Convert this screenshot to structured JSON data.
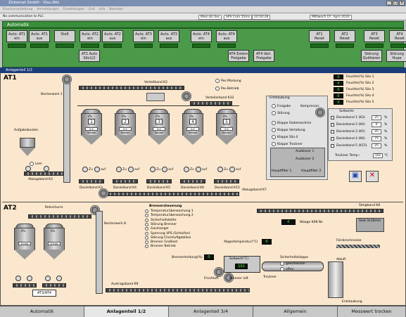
{
  "window": {
    "title": "Zirkomat GmbH",
    "title_suffix": "Visu.Wiz"
  },
  "toolbar": {
    "items": [
      "Druckverarbeitung",
      "Anmeldungen",
      "Einstellungen",
      "Exit",
      "Info",
      "Beenden"
    ]
  },
  "status": {
    "message": "No communication to PLC",
    "main": "Main 82.0ec",
    "sps": "SPS Com 55ms",
    "time": "10:50:28",
    "date": "Mittwoch 07. April 2010"
  },
  "auto": {
    "label": "Automatik",
    "buttons": [
      {
        "l1": "Auto. AT1",
        "l2": "ein"
      },
      {
        "l1": "Auto. AT1",
        "l2": "aus"
      },
      {
        "l1": "Stoß",
        "l2": ""
      },
      {
        "l1": "Auto. AT2",
        "l2": "ein"
      },
      {
        "l1": "Auto. AT2",
        "l2": "aus"
      },
      {
        "l1": "Auto. AT3",
        "l2": "ein"
      },
      {
        "l1": "Auto. AT3",
        "l2": "aus"
      },
      {
        "l1": "Auto. AT4",
        "l2": "ein"
      },
      {
        "l1": "Auto. AT4",
        "l2": "aus"
      },
      {
        "l1": "AT1",
        "l2": "Reset"
      },
      {
        "l1": "AT2",
        "l2": "Reset"
      },
      {
        "l1": "AT3",
        "l2": "Reset"
      },
      {
        "l1": "AT4",
        "l2": "Reset"
      }
    ],
    "buttons2": [
      {
        "l1": "AT2 Auto",
        "l2": "Silo1/2"
      },
      {
        "l1": "AT4 Extern",
        "l2": "Freigabe"
      },
      {
        "l1": "AT4 Verl.",
        "l2": "Freigabe"
      },
      {
        "l1": "Störung",
        "l2": "Quittieren"
      },
      {
        "l1": "Störung",
        "l2": "Hupe"
      }
    ]
  },
  "sub": {
    "title": "Anlagenteil 1/2"
  },
  "at1": {
    "title": "AT1",
    "labels": {
      "becherwerk": "Becherwerk 1",
      "verteilband": "Verteilband K2",
      "vb_k32": "Verteilerband K32",
      "pos_mark": "Pos.Markung",
      "pos_betrieb": "Pos.Betrieb",
      "aufgabe": "Aufgabebunker",
      "leer": "Leer",
      "abzug": "Abzugsband K3",
      "abzug2": "Abzugsband K7"
    },
    "silos": [
      {
        "n": "1",
        "pct": "0%",
        "txt": "0.2 Shilder"
      },
      {
        "n": "2",
        "pct": "0%",
        "txt": "0.2 Shilder"
      },
      {
        "n": "3",
        "pct": "0%",
        "txt": "0.2 Shilder"
      },
      {
        "n": "4",
        "pct": "0%",
        "txt": "0.2 Shilder"
      },
      {
        "n": "5",
        "pct": "0%",
        "txt": "0.2 Shilder"
      }
    ],
    "dosierband": [
      "Dosierband K3",
      "Dosierband K4",
      "Dosierband K5",
      "Dosierband K6",
      "Dosierband K15"
    ],
    "valves": [
      "Zu",
      "auf"
    ],
    "entstaubung": {
      "title": "Entstaubung",
      "freigabe": "Freigabe",
      "storung": "Störung",
      "kompressor": "Kompressor",
      "items": [
        "Klappe Siebmaschine",
        "Klappe Verladung",
        "Klappe Silo 4",
        "Klappe Trockner"
      ],
      "ausblaser1": "Ausblaser 1",
      "ausblaser2": "Ausblaser 2",
      "haupt1": "Hauptfilter 1",
      "haupt2": "Hauptfilter 2"
    },
    "feuchte": [
      "Feuchte(%) Silo 1",
      "Feuchte(%) Silo 2",
      "Feuchte(%) Silo 3",
      "Feuchte(%) Silo 4",
      "Feuchte(%) Silo 5"
    ],
    "feuchte_vals": [
      "0",
      "0",
      "0",
      "0",
      "0"
    ],
    "sollwerte": {
      "title": "Sollwerte",
      "items": [
        "Dosierband 1 (K3)",
        "Dosierband 2 (K4)",
        "Dosierband 3 (K5)",
        "Dosierband 4 (K6)",
        "Dosierband 5 (K15)"
      ],
      "values": [
        "25",
        "0",
        "25",
        "75",
        "25"
      ],
      "unit": "%",
      "temp_label": "Trockner Temp.:",
      "temp_val": "102",
      "temp_unit": "°C"
    }
  },
  "at2": {
    "title": "AT2",
    "labels": {
      "rohschurre": "Rohschurre",
      "becherwerk": "Becherwerk 8",
      "brenner": "Brennersteuerung",
      "steigband": "Steigband K8",
      "waage": "Waage K08 Nz",
      "sieb": "Sieb 3x10mm",
      "foerder": "Förderschnecke",
      "abgas": "Abgastemperatur(°C)",
      "brennerleistung": "Brennerleistung(%)",
      "sollwert": "Sollwert(°C)",
      "frischluft": "Frischluft",
      "brenner_luft": "Brenner luft",
      "sicherheit": "Sicherheitsklappe",
      "geschlossen": "geschlossen",
      "offen": "offen",
      "abluft": "Abluft",
      "trockner": "Trockner",
      "entstaubung": "Entstaubung",
      "austragband": "Austragsband K9",
      "at34": "AT3/AT4"
    },
    "brenner_items": [
      "Temperaturüberwachung 1",
      "Temperaturüberwachung 2",
      "Sicherheitskette",
      "Störung Brenner",
      "Gasmangel",
      "Sperrung VPS (Schleifen)",
      "Störung Frischluftgebläse",
      "Brenner Großlast",
      "Brenner Betrieb"
    ],
    "abgas_val": "0",
    "brenner_val": "0",
    "soll_val": "102",
    "waage_val": "0",
    "silos": [
      {
        "pct": "0%",
        "txt": "0 mm"
      },
      {
        "pct": "0%",
        "txt": "0 mm"
      }
    ]
  },
  "tabs": [
    "Automatik",
    "Anlagenteil 1/2",
    "Anlagenteil 3/4",
    "Allgemein",
    "Messwert trocken"
  ],
  "colors": {
    "green": "#4a9a4a",
    "beige": "#fbe7cd",
    "title": "#1a3d7a"
  }
}
